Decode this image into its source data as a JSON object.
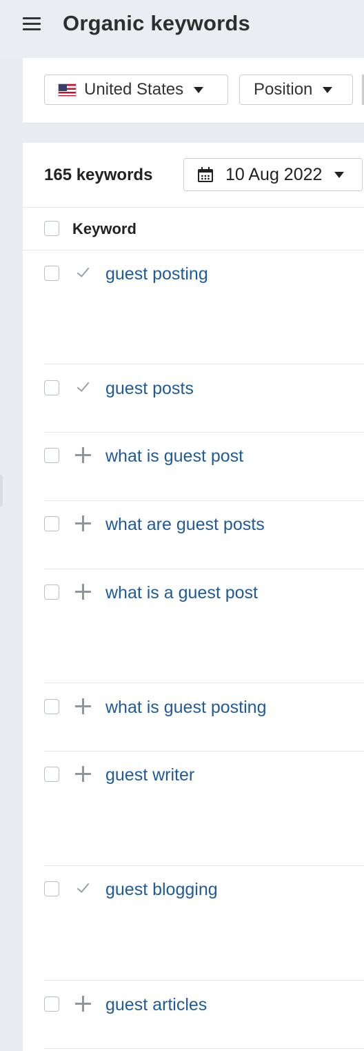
{
  "header": {
    "title": "Organic keywords"
  },
  "filters": {
    "country": {
      "label": "United States",
      "flag_icon": "us-flag-icon"
    },
    "position": {
      "label": "Position"
    }
  },
  "table": {
    "count_label": "165 keywords",
    "date_label": "10 Aug 2022",
    "column_header": "Keyword",
    "rows": [
      {
        "keyword": "guest posting",
        "status": "check"
      },
      {
        "keyword": "guest posts",
        "status": "check"
      },
      {
        "keyword": "what is guest post",
        "status": "plus"
      },
      {
        "keyword": "what are guest posts",
        "status": "plus"
      },
      {
        "keyword": "what is a guest post",
        "status": "plus"
      },
      {
        "keyword": "what is guest posting",
        "status": "plus"
      },
      {
        "keyword": "guest writer",
        "status": "plus"
      },
      {
        "keyword": "guest blogging",
        "status": "check"
      },
      {
        "keyword": "guest articles",
        "status": "plus"
      }
    ]
  },
  "colors": {
    "link": "#1f5a9a",
    "page_bg": "#e9edf1",
    "icon_gray": "#9aa0a6"
  }
}
